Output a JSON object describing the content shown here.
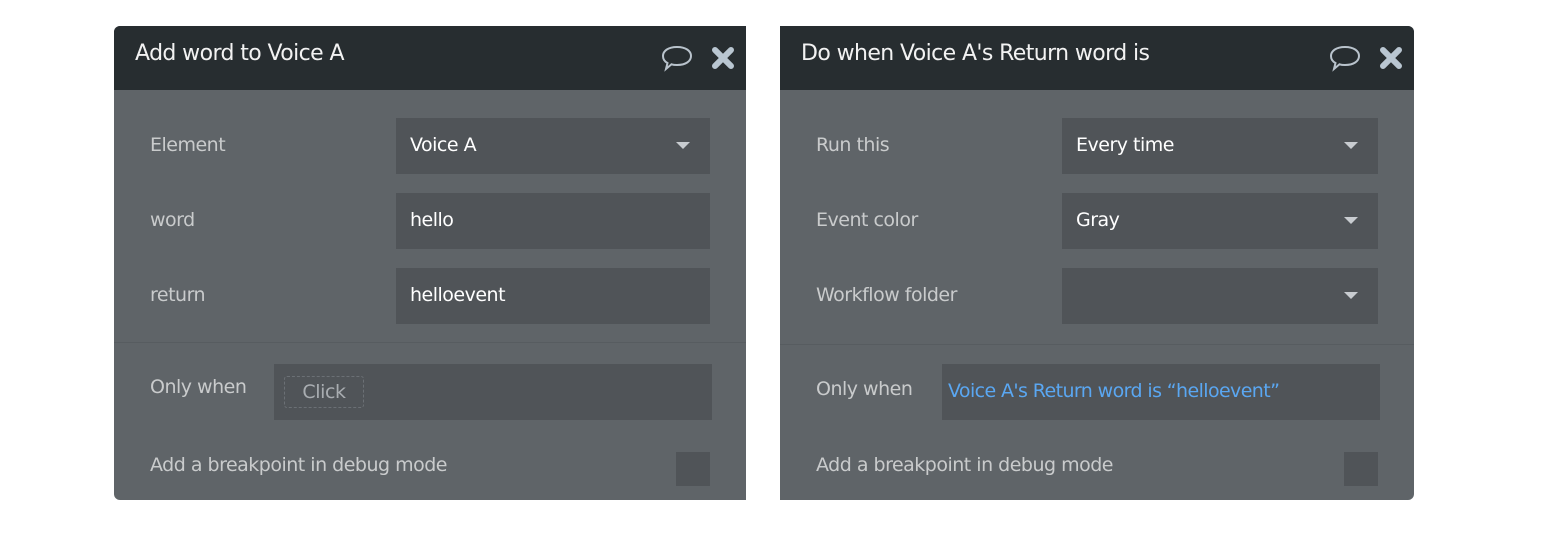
{
  "left_panel": {
    "title": "Add word to Voice A",
    "icons": {
      "comment": "speech-bubble-icon",
      "close": "close-icon"
    },
    "fields": [
      {
        "label": "Element",
        "value": "Voice A",
        "type": "dropdown"
      },
      {
        "label": "word",
        "value": "hello",
        "type": "text"
      },
      {
        "label": "return",
        "value": "helloevent",
        "type": "text"
      }
    ],
    "only_when": {
      "label": "Only when",
      "placeholder": "Click"
    },
    "breakpoint": {
      "label": "Add a breakpoint in debug mode",
      "checked": false
    }
  },
  "right_panel": {
    "title": "Do when Voice A's Return word is",
    "icons": {
      "comment": "speech-bubble-icon",
      "close": "close-icon"
    },
    "fields": [
      {
        "label": "Run this",
        "value": "Every time",
        "type": "dropdown"
      },
      {
        "label": "Event color",
        "value": "Gray",
        "type": "dropdown"
      },
      {
        "label": "Workflow folder",
        "value": "",
        "type": "dropdown"
      }
    ],
    "only_when": {
      "label": "Only when",
      "expression": "Voice A's Return word is “helloevent”"
    },
    "breakpoint": {
      "label": "Add a breakpoint in debug mode",
      "checked": false
    }
  },
  "colors": {
    "header_bg": "#272d30",
    "panel_bg": "#5f6468",
    "field_bg": "#505458",
    "expression_blue": "#5aa7f2"
  }
}
